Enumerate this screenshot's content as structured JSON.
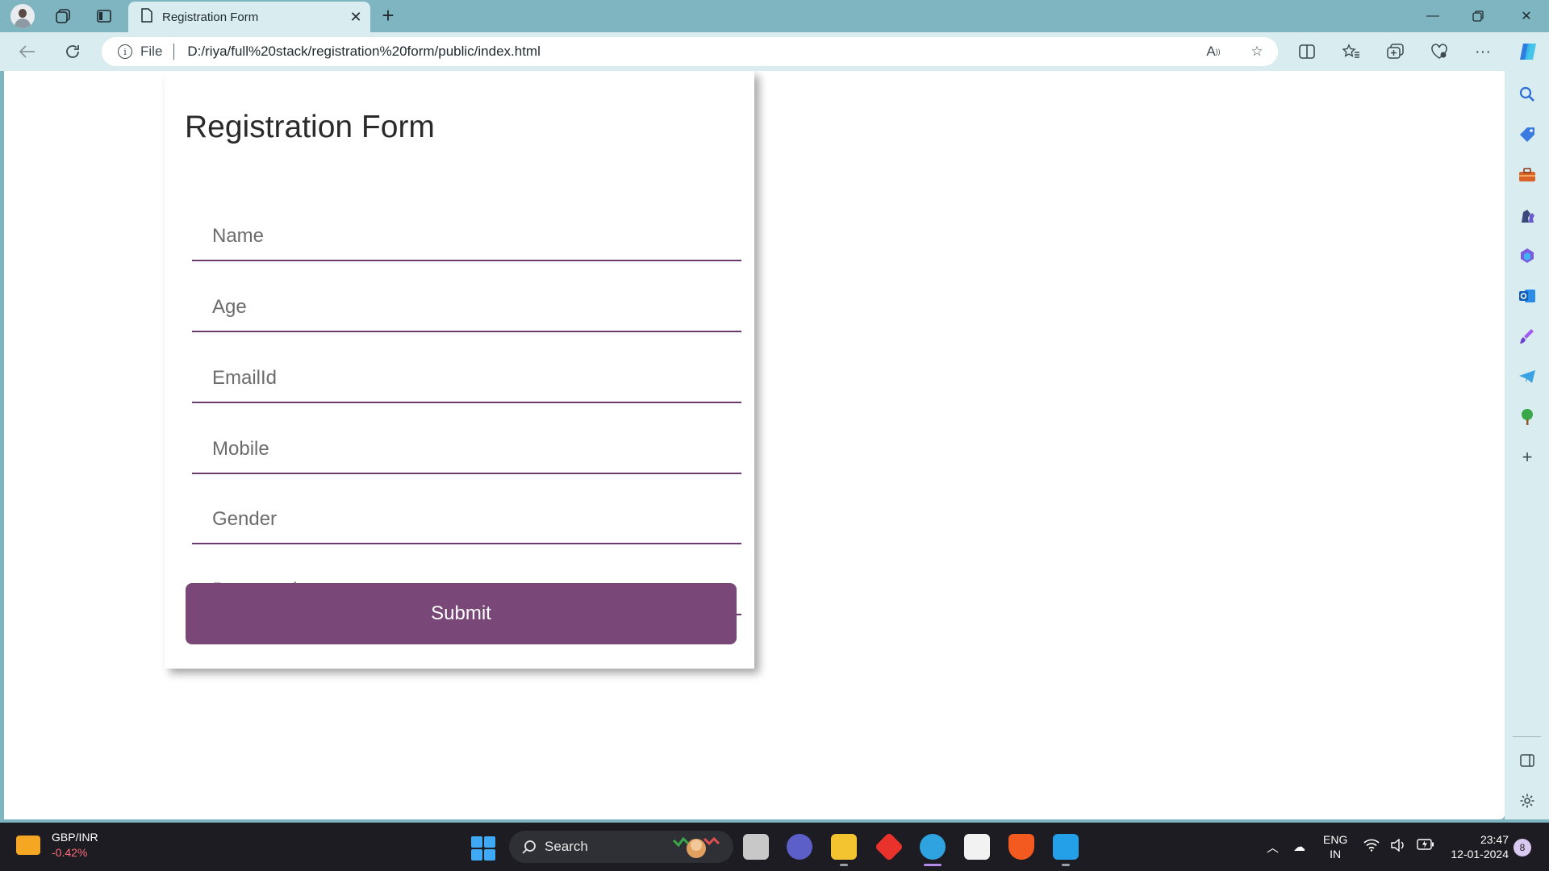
{
  "browser": {
    "tab": {
      "title": "Registration Form"
    },
    "address": {
      "scheme_label": "File",
      "url": "D:/riya/full%20stack/registration%20form/public/index.html"
    }
  },
  "page": {
    "title": "Registration Form",
    "fields": [
      {
        "name": "name-field",
        "placeholder": "Name"
      },
      {
        "name": "age-field",
        "placeholder": "Age"
      },
      {
        "name": "email-field",
        "placeholder": "EmailId"
      },
      {
        "name": "mobile-field",
        "placeholder": "Mobile"
      },
      {
        "name": "gender-field",
        "placeholder": "Gender"
      },
      {
        "name": "password-field",
        "placeholder": "Password"
      }
    ],
    "submit_label": "Submit"
  },
  "taskbar": {
    "widget": {
      "name": "GBP/INR",
      "change": "-0.42%"
    },
    "search_label": "Search",
    "language": {
      "line1": "ENG",
      "line2": "IN"
    },
    "clock": {
      "time": "23:47",
      "date": "12-01-2024"
    },
    "notification_count": "8"
  },
  "colors": {
    "accent": "#7a4878",
    "field_underline": "#6b3a6f",
    "browser_frame": "#7fb5c1",
    "toolbar": "#d9ecef"
  }
}
